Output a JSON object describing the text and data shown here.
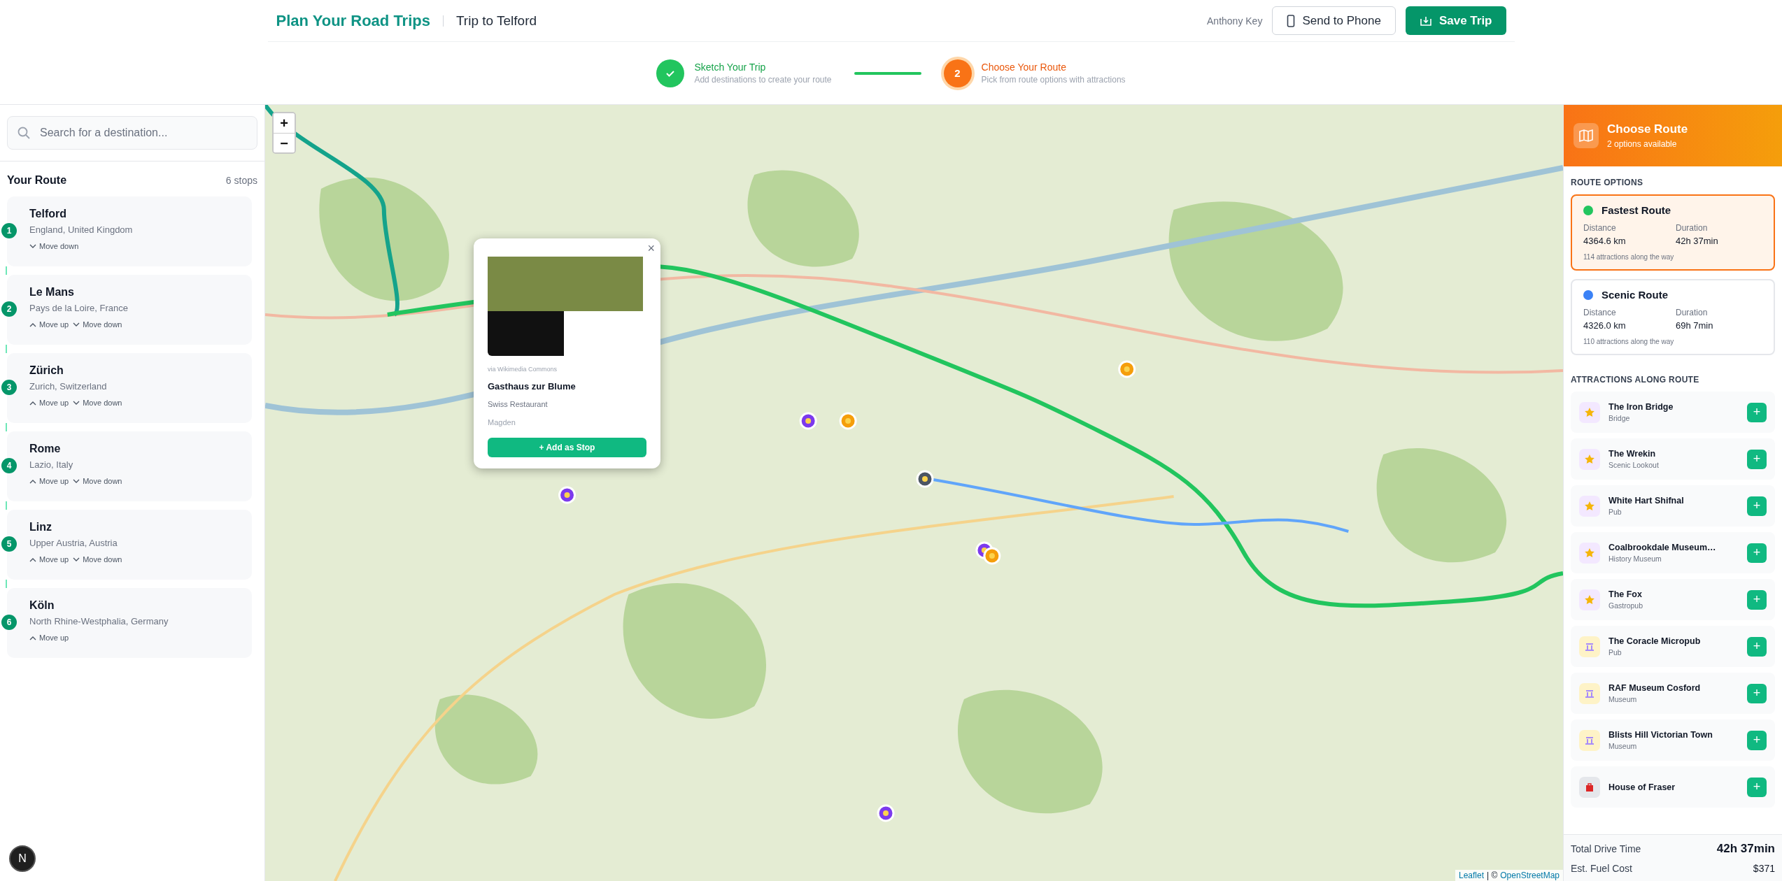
{
  "header": {
    "title": "Plan Your Road Trips",
    "trip": "Trip to Telford",
    "user": "Anthony Key",
    "send_button": "Send to Phone",
    "save_button": "Save Trip"
  },
  "steps": [
    {
      "completed": true,
      "title": "Sketch Your Trip",
      "subtitle": "Add destinations to create your route"
    },
    {
      "completed": false,
      "number": "2",
      "title": "Choose Your Route",
      "subtitle": "Pick from route options with attractions"
    }
  ],
  "sidebar": {
    "search": {
      "placeholder": "Search for a destination..."
    },
    "heading": "Your Route",
    "count": "6 stops",
    "stops": [
      {
        "number": "1",
        "name": "Telford",
        "region": "England, United Kingdom",
        "actions": [
          {
            "kind": "down",
            "label": "Move down"
          }
        ]
      },
      {
        "number": "2",
        "name": "Le Mans",
        "region": "Pays de la Loire, France",
        "actions": [
          {
            "kind": "up",
            "label": "Move up"
          },
          {
            "kind": "down",
            "label": "Move down"
          }
        ]
      },
      {
        "number": "3",
        "name": "Zürich",
        "region": "Zurich, Switzerland",
        "actions": [
          {
            "kind": "up",
            "label": "Move up"
          },
          {
            "kind": "down",
            "label": "Move down"
          }
        ]
      },
      {
        "number": "4",
        "name": "Rome",
        "region": "Lazio, Italy",
        "actions": [
          {
            "kind": "up",
            "label": "Move up"
          },
          {
            "kind": "down",
            "label": "Move down"
          }
        ]
      },
      {
        "number": "5",
        "name": "Linz",
        "region": "Upper Austria, Austria",
        "actions": [
          {
            "kind": "up",
            "label": "Move up"
          },
          {
            "kind": "down",
            "label": "Move down"
          }
        ]
      },
      {
        "number": "6",
        "name": "Köln",
        "region": "North Rhine-Westphalia, Germany",
        "actions": [
          {
            "kind": "up",
            "label": "Move up"
          }
        ]
      }
    ],
    "dev_badge": "N"
  },
  "map": {
    "zoom_in": "+",
    "zoom_out": "−",
    "attribution_leaflet": "Leaflet",
    "attribution_sep": "| ©",
    "attribution_osm": "OpenStreetMap",
    "popup": {
      "close": "×",
      "credit": "via Wikimedia Commons",
      "name": "Gasthaus zur Blume",
      "category": "Swiss Restaurant",
      "place": "Magden",
      "button": "+ Add as Stop"
    }
  },
  "panel": {
    "title": "Choose Route",
    "subtitle": "2 options available",
    "options_heading": "ROUTE OPTIONS",
    "routes": [
      {
        "name": "Fastest Route",
        "color": "#22c55e",
        "selected": true,
        "distance_label": "Distance",
        "distance": "4364.6 km",
        "duration_label": "Duration",
        "duration": "42h 37min",
        "attractions": "114 attractions along the way"
      },
      {
        "name": "Scenic Route",
        "color": "#3b82f6",
        "selected": false,
        "distance_label": "Distance",
        "distance": "4326.0 km",
        "duration_label": "Duration",
        "duration": "69h 7min",
        "attractions": "110 attractions along the way"
      }
    ],
    "attractions_heading": "ATTRACTIONS ALONG ROUTE",
    "attractions": [
      {
        "kind": "star",
        "name": "The Iron Bridge",
        "type": "Bridge"
      },
      {
        "kind": "star",
        "name": "The Wrekin",
        "type": "Scenic Lookout"
      },
      {
        "kind": "star",
        "name": "White Hart Shifnal",
        "type": "Pub"
      },
      {
        "kind": "star",
        "name": "Coalbrookdale Museum…",
        "type": "History Museum"
      },
      {
        "kind": "star",
        "name": "The Fox",
        "type": "Gastropub"
      },
      {
        "kind": "landmark",
        "name": "The Coracle Micropub",
        "type": "Pub"
      },
      {
        "kind": "landmark",
        "name": "RAF Museum Cosford",
        "type": "Museum"
      },
      {
        "kind": "landmark",
        "name": "Blists Hill Victorian Town",
        "type": "Museum"
      },
      {
        "kind": "shop",
        "name": "House of Fraser"
      }
    ],
    "add_label": "+",
    "totals": [
      {
        "label": "Total Drive Time",
        "value": "42h 37min",
        "emphasis": true
      },
      {
        "label": "Est. Fuel Cost",
        "value": "$371",
        "emphasis": false
      }
    ]
  }
}
